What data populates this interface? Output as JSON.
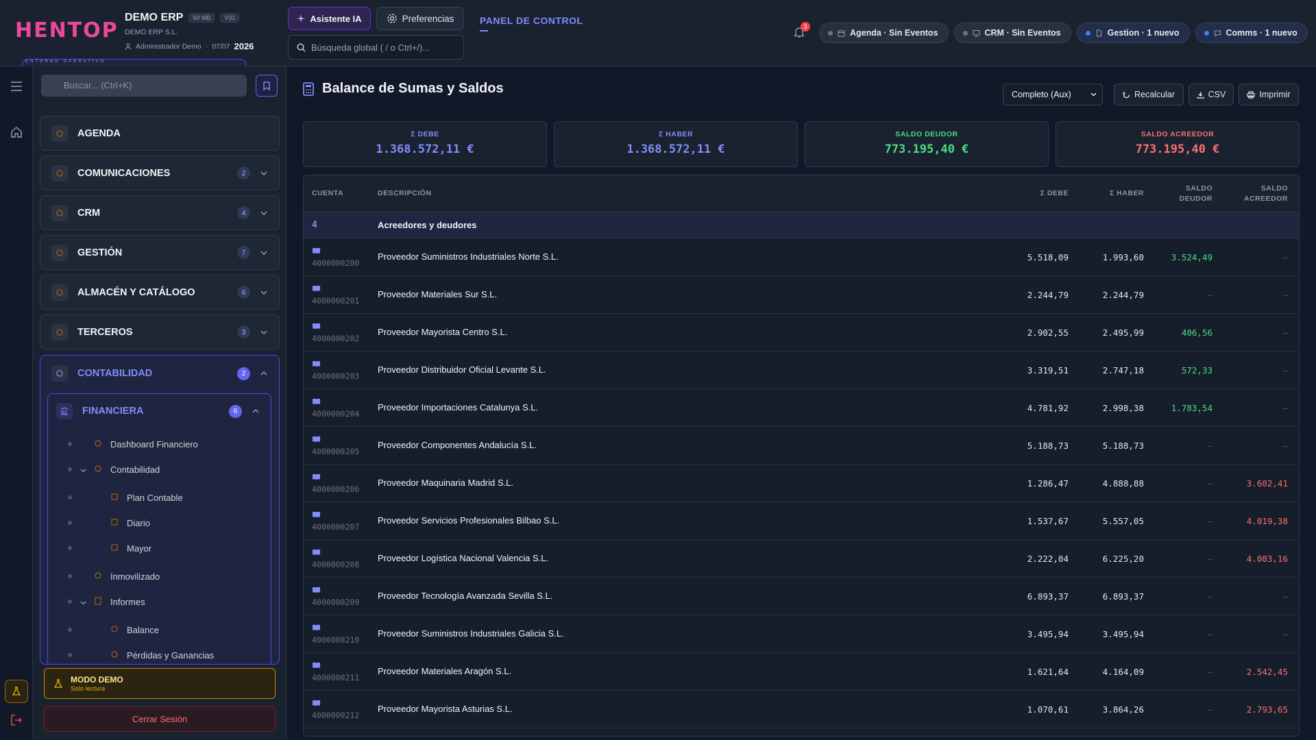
{
  "header": {
    "logo_text": "HENTOP",
    "logo_sub": "ENTORNO OPERATIVO",
    "app_name": "DEMO ERP",
    "size_tag": "60 MB",
    "version_tag": "V31",
    "company": "DEMO ERP S.L.",
    "user": "Administrador Demo",
    "date": "07/07",
    "year": "2026",
    "ai_button": "Asistente IA",
    "prefs_button": "Preferencias",
    "search_placeholder": "Búsqueda global ( / o Ctrl+/)...",
    "panel_title": "PANEL DE CONTROL",
    "notif_count": "3",
    "pills": [
      {
        "label": "Agenda · Sin Eventos",
        "icon": "calendar-icon",
        "active": false
      },
      {
        "label": "CRM · Sin Eventos",
        "icon": "monitor-icon",
        "active": false
      },
      {
        "label": "Gestion · 1 nuevo",
        "icon": "document-icon",
        "active": true
      },
      {
        "label": "Comms · 1 nuevo",
        "icon": "chat-icon",
        "active": true
      }
    ]
  },
  "sidebar": {
    "search_placeholder": "Buscar... (Ctrl+K)",
    "items": [
      {
        "label": "AGENDA",
        "count": ""
      },
      {
        "label": "COMUNICACIONES",
        "count": "2"
      },
      {
        "label": "CRM",
        "count": "4"
      },
      {
        "label": "GESTIÓN",
        "count": "7"
      },
      {
        "label": "ALMACÉN Y CATÁLOGO",
        "count": "6"
      },
      {
        "label": "TERCEROS",
        "count": "3"
      }
    ],
    "active_section": {
      "label": "CONTABILIDAD",
      "count": "2"
    },
    "active_sub": {
      "label": "FINANCIERA",
      "count": "6"
    },
    "tree": [
      "Dashboard Financiero",
      "Contabilidad",
      "Plan Contable",
      "Diario",
      "Mayor",
      "Inmovilizado",
      "Informes",
      "Balance",
      "Pérdidas y Ganancias"
    ],
    "demo_title": "MODO DEMO",
    "demo_sub": "Solo lectura",
    "logout": "Cerrar Sesión"
  },
  "main": {
    "title": "Balance de Sumas y Saldos",
    "view_select": "Completo (Aux)",
    "recalc": "Recalcular",
    "csv": "CSV",
    "print": "Imprimir",
    "cards": [
      {
        "label": "Σ DEBE",
        "value": "1.368.572,11 €",
        "color": "#818cf8"
      },
      {
        "label": "Σ HABER",
        "value": "1.368.572,11 €",
        "color": "#818cf8"
      },
      {
        "label": "SALDO DEUDOR",
        "value": "773.195,40 €",
        "color": "#4ade80"
      },
      {
        "label": "SALDO ACREEDOR",
        "value": "773.195,40 €",
        "color": "#f87171"
      }
    ],
    "columns": {
      "cuenta": "CUENTA",
      "descripcion": "DESCRIPCIÓN",
      "debe": "Σ DEBE",
      "haber": "Σ HABER",
      "deudor_1": "SALDO",
      "deudor_2": "DEUDOR",
      "acreedor_1": "SALDO",
      "acreedor_2": "ACREEDOR"
    },
    "group": {
      "code": "4",
      "name": "Acreedores y deudores"
    },
    "rows": [
      {
        "code": "4000000200",
        "desc": "Proveedor Suministros Industriales Norte S.L.",
        "debe": "5.518,09",
        "haber": "1.993,60",
        "deudor": "3.524,49",
        "acreedor": "—"
      },
      {
        "code": "4000000201",
        "desc": "Proveedor Materiales Sur S.L.",
        "debe": "2.244,79",
        "haber": "2.244,79",
        "deudor": "—",
        "acreedor": "—"
      },
      {
        "code": "4000000202",
        "desc": "Proveedor Mayorista Centro S.L.",
        "debe": "2.902,55",
        "haber": "2.495,99",
        "deudor": "406,56",
        "acreedor": "—"
      },
      {
        "code": "4000000203",
        "desc": "Proveedor Distribuidor Oficial Levante S.L.",
        "debe": "3.319,51",
        "haber": "2.747,18",
        "deudor": "572,33",
        "acreedor": "—"
      },
      {
        "code": "4000000204",
        "desc": "Proveedor Importaciones Catalunya S.L.",
        "debe": "4.781,92",
        "haber": "2.998,38",
        "deudor": "1.783,54",
        "acreedor": "—"
      },
      {
        "code": "4000000205",
        "desc": "Proveedor Componentes Andalucía S.L.",
        "debe": "5.188,73",
        "haber": "5.188,73",
        "deudor": "—",
        "acreedor": "—"
      },
      {
        "code": "4000000206",
        "desc": "Proveedor Maquinaria Madrid S.L.",
        "debe": "1.286,47",
        "haber": "4.888,88",
        "deudor": "—",
        "acreedor": "3.602,41"
      },
      {
        "code": "4000000207",
        "desc": "Proveedor Servicios Profesionales Bilbao S.L.",
        "debe": "1.537,67",
        "haber": "5.557,05",
        "deudor": "—",
        "acreedor": "4.019,38"
      },
      {
        "code": "4000000208",
        "desc": "Proveedor Logística Nacional Valencia S.L.",
        "debe": "2.222,04",
        "haber": "6.225,20",
        "deudor": "—",
        "acreedor": "4.003,16"
      },
      {
        "code": "4000000209",
        "desc": "Proveedor Tecnología Avanzada Sevilla S.L.",
        "debe": "6.893,37",
        "haber": "6.893,37",
        "deudor": "—",
        "acreedor": "—"
      },
      {
        "code": "4000000210",
        "desc": "Proveedor Suministros Industriales Galicia S.L.",
        "debe": "3.495,94",
        "haber": "3.495,94",
        "deudor": "—",
        "acreedor": "—"
      },
      {
        "code": "4000000211",
        "desc": "Proveedor Materiales Aragón S.L.",
        "debe": "1.621,64",
        "haber": "4.164,09",
        "deudor": "—",
        "acreedor": "2.542,45"
      },
      {
        "code": "4000000212",
        "desc": "Proveedor Mayorista Asturias S.L.",
        "debe": "1.070,61",
        "haber": "3.864,26",
        "deudor": "—",
        "acreedor": "2.793,65"
      }
    ]
  }
}
